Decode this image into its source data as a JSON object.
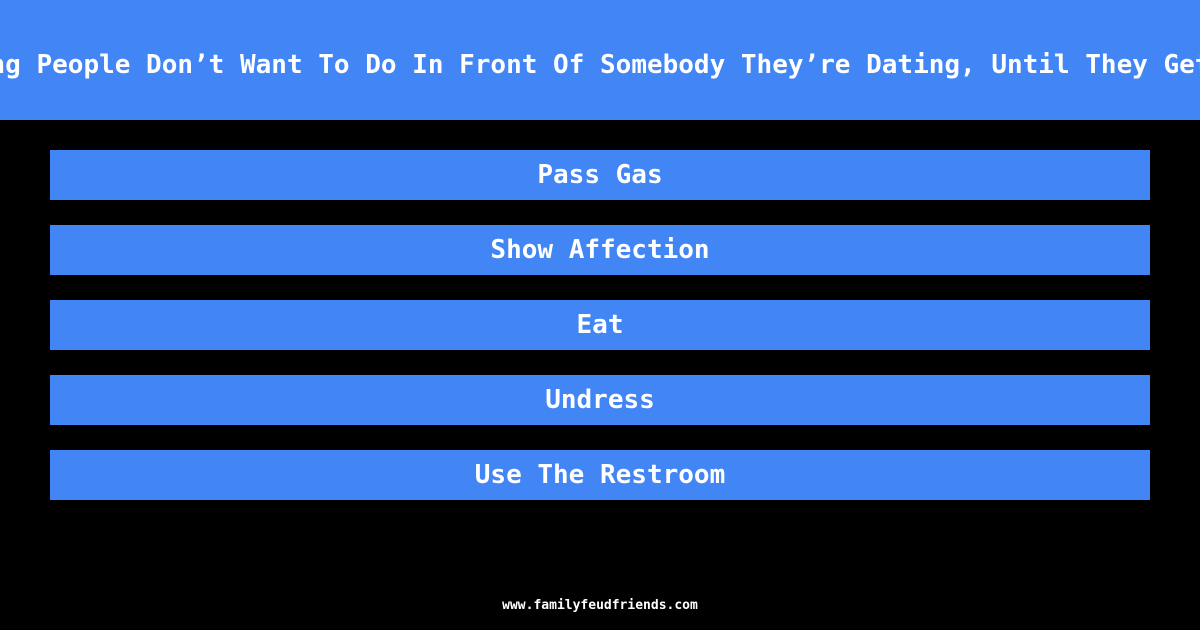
{
  "question": "Name Something People Don’t Want To Do In Front Of Somebody They’re Dating, Until They Get Comfortable",
  "answers": [
    "Pass Gas",
    "Show Affection",
    "Eat",
    "Undress",
    "Use The Restroom"
  ],
  "footer": "www.familyfeudfriends.com",
  "colors": {
    "accent": "#4285f4",
    "background": "#000000",
    "text": "#ffffff"
  }
}
